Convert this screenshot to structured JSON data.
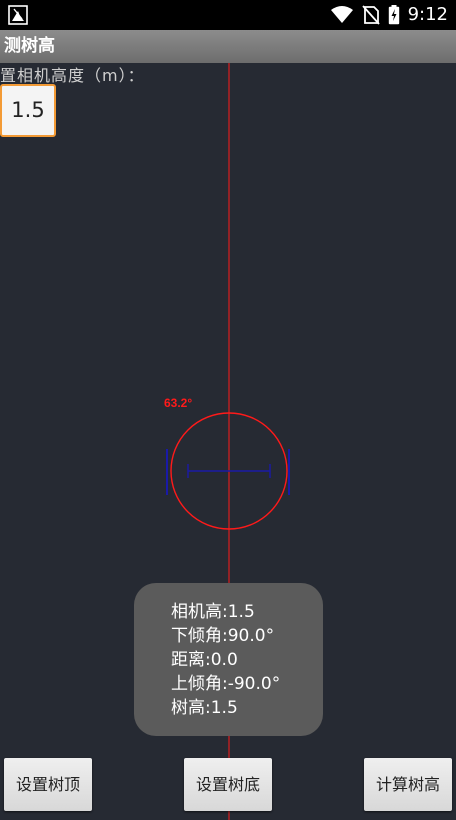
{
  "status_bar": {
    "time": "9:12",
    "icons": [
      "notification-icon",
      "wifi-icon",
      "no-sim-icon",
      "battery-charging-icon"
    ]
  },
  "app_bar": {
    "title": "测树高"
  },
  "camera_height": {
    "label": "置相机高度（m）：",
    "value": "1.5"
  },
  "reticle": {
    "angle_label": "63.2°",
    "color_line": "#ff1a1a",
    "color_level": "#1a1aa8"
  },
  "info": {
    "camera_height": "相机高:1.5",
    "down_angle": "下倾角:90.0°",
    "distance": "距离:0.0",
    "up_angle": "上倾角:-90.0°",
    "tree_height": "树高:1.5"
  },
  "buttons": {
    "set_top": "设置树顶",
    "set_bottom": "设置树底",
    "compute": "计算树高"
  }
}
